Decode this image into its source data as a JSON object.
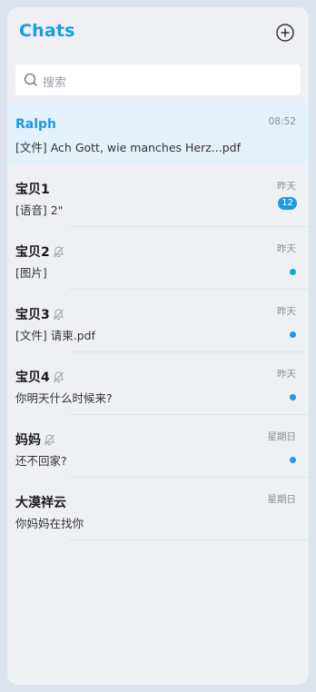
{
  "header": {
    "title": "Chats",
    "add_icon": "plus-circle-icon"
  },
  "search": {
    "placeholder": "搜索",
    "icon": "search-icon"
  },
  "accent_color": "#1c9ae6",
  "chats": [
    {
      "name": "Ralph",
      "preview": "[文件] Ach Gott, wie manches Herz...pdf",
      "time": "08:52",
      "muted": false,
      "active": true
    },
    {
      "name": "宝贝1",
      "preview": "[语音] 2\"",
      "time": "昨天",
      "muted": false,
      "badge": "12"
    },
    {
      "name": "宝贝2",
      "preview": "[图片]",
      "time": "昨天",
      "muted": true,
      "dot": true
    },
    {
      "name": "宝贝3",
      "preview": "[文件] 请柬.pdf",
      "time": "昨天",
      "muted": true,
      "dot": true
    },
    {
      "name": "宝贝4",
      "preview": "你明天什么时候来?",
      "time": "昨天",
      "muted": true,
      "dot": true
    },
    {
      "name": "妈妈",
      "preview": "还不回家?",
      "time": "星期日",
      "muted": true,
      "dot": true
    },
    {
      "name": "大漠祥云",
      "preview": "你妈妈在找你",
      "time": "星期日",
      "muted": false
    }
  ]
}
